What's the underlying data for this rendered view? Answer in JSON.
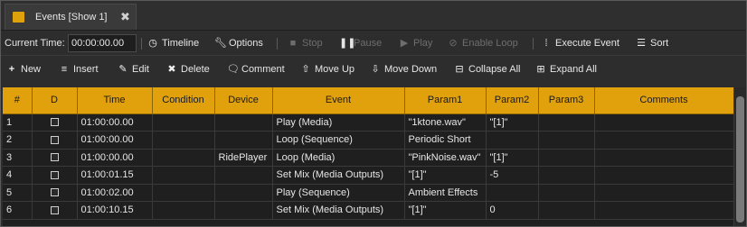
{
  "tab": {
    "title": "Events [Show 1]",
    "close": "✖"
  },
  "toolbar1": {
    "current_time_label": "Current Time:",
    "current_time_value": "00:00:00.00",
    "timeline": "Timeline",
    "options": "Options",
    "stop": "Stop",
    "pause": "Pause",
    "play": "Play",
    "enable_loop": "Enable Loop",
    "execute_event": "Execute Event",
    "sort": "Sort"
  },
  "toolbar2": {
    "new": "New",
    "insert": "Insert",
    "edit": "Edit",
    "delete": "Delete",
    "comment": "Comment",
    "move_up": "Move Up",
    "move_down": "Move Down",
    "collapse_all": "Collapse All",
    "expand_all": "Expand All"
  },
  "grid": {
    "columns": [
      "#",
      "D",
      "Time",
      "Condition",
      "Device",
      "Event",
      "Param1",
      "Param2",
      "Param3",
      "Comments"
    ],
    "rows": [
      {
        "num": "1",
        "time": "01:00:00.00",
        "condition": "",
        "device": "",
        "event": "Play (Media)",
        "param1": "\"1ktone.wav\"",
        "param2": "\"[1]\"",
        "param3": "",
        "comments": ""
      },
      {
        "num": "2",
        "time": "01:00:00.00",
        "condition": "",
        "device": "",
        "event": "Loop (Sequence)",
        "param1": "Periodic Short",
        "param2": "",
        "param3": "",
        "comments": ""
      },
      {
        "num": "3",
        "time": "01:00:00.00",
        "condition": "",
        "device": "RidePlayer",
        "event": "Loop (Media)",
        "param1": "\"PinkNoise.wav\"",
        "param2": "\"[1]\"",
        "param3": "",
        "comments": ""
      },
      {
        "num": "4",
        "time": "01:00:01.15",
        "condition": "",
        "device": "",
        "event": "Set Mix (Media Outputs)",
        "param1": "\"[1]\"",
        "param2": "-5",
        "param3": "",
        "comments": ""
      },
      {
        "num": "5",
        "time": "01:00:02.00",
        "condition": "",
        "device": "",
        "event": "Play (Sequence)",
        "param1": "Ambient Effects",
        "param2": "",
        "param3": "",
        "comments": ""
      },
      {
        "num": "6",
        "time": "01:00:10.15",
        "condition": "",
        "device": "",
        "event": "Set Mix (Media Outputs)",
        "param1": "\"[1]\"",
        "param2": "0",
        "param3": "",
        "comments": ""
      }
    ]
  },
  "colors": {
    "header_accent": "#e1a10d",
    "tab_icon": "#e0a20c",
    "background": "#2d2d2d"
  }
}
